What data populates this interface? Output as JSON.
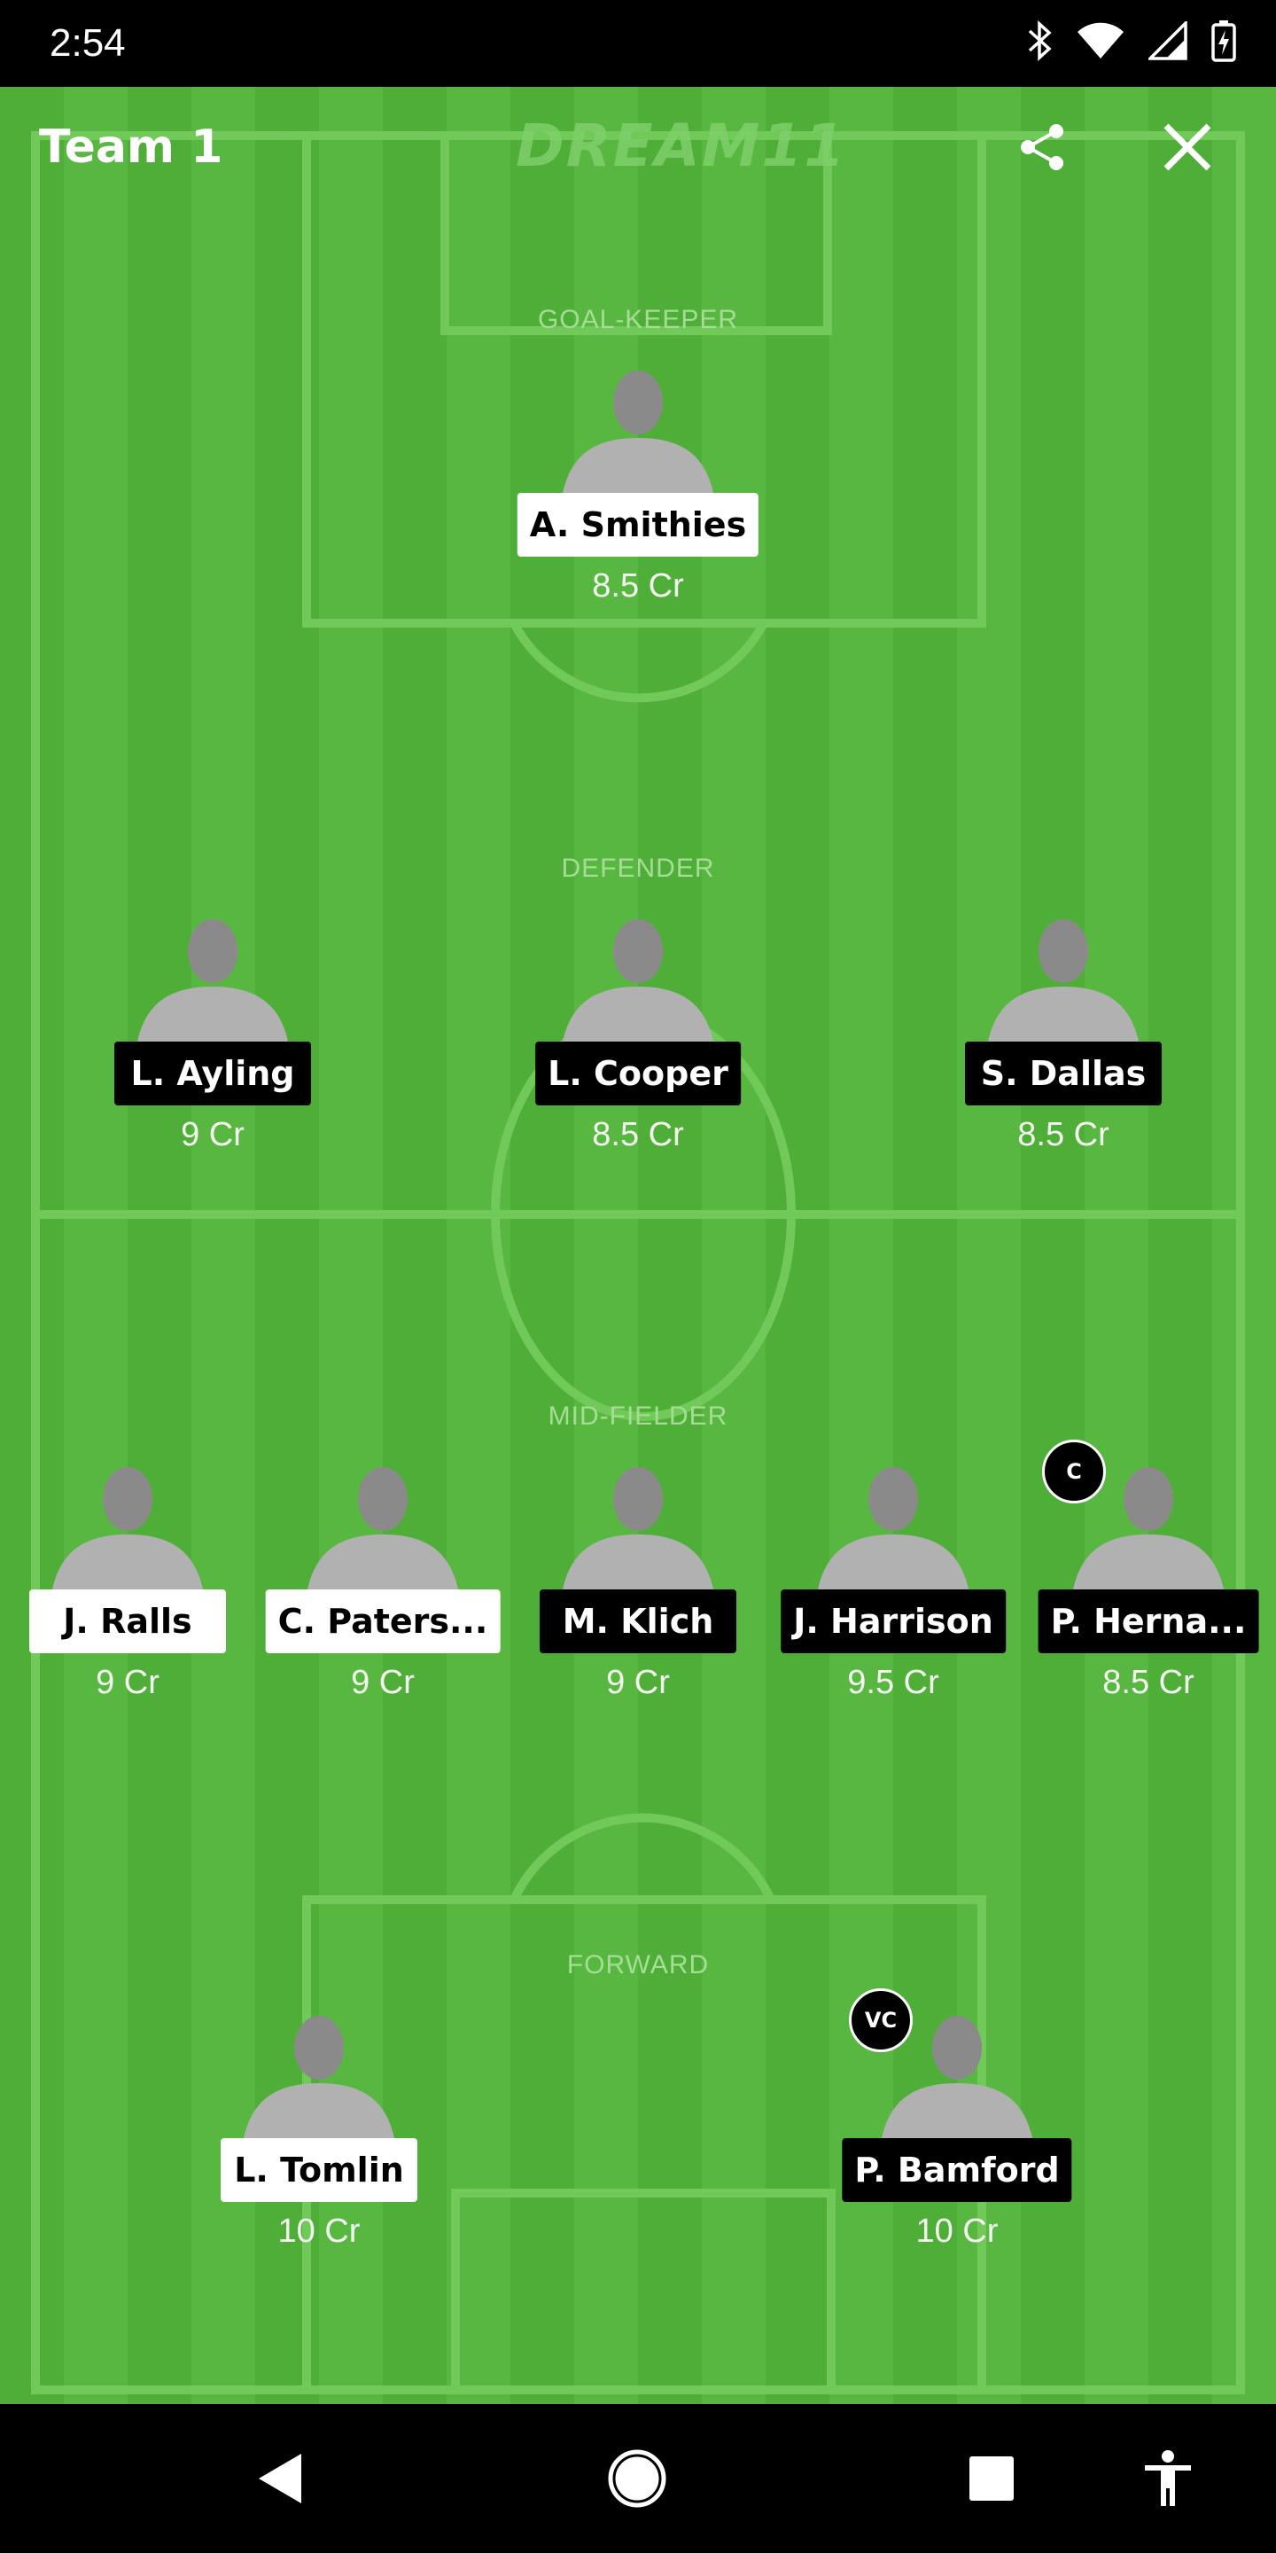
{
  "status": {
    "time": "2:54"
  },
  "header": {
    "team_name": "Team 1",
    "brand": "DREAM11"
  },
  "sections": {
    "goalkeeper": "GOAL-KEEPER",
    "defender": "DEFENDER",
    "midfielder": "MID-FIELDER",
    "forward": "FORWARD"
  },
  "players": {
    "gk": [
      {
        "name": "A. Smithies",
        "credits": "8.5 Cr"
      }
    ],
    "def": [
      {
        "name": "L. Ayling",
        "credits": "9 Cr"
      },
      {
        "name": "L. Cooper",
        "credits": "8.5 Cr"
      },
      {
        "name": "S. Dallas",
        "credits": "8.5 Cr"
      }
    ],
    "mid": [
      {
        "name": "J. Ralls",
        "credits": "9 Cr"
      },
      {
        "name": "C. Paters...",
        "credits": "9 Cr"
      },
      {
        "name": "M. Klich",
        "credits": "9 Cr"
      },
      {
        "name": "J. Harrison",
        "credits": "9.5 Cr"
      },
      {
        "name": "P. Herna...",
        "credits": "8.5 Cr",
        "badge": "C"
      }
    ],
    "fwd": [
      {
        "name": "L. Tomlin",
        "credits": "10 Cr"
      },
      {
        "name": "P. Bamford",
        "credits": "10 Cr",
        "badge": "VC"
      }
    ]
  },
  "icons": {
    "share": "share-icon",
    "close": "close-icon",
    "back": "back-triangle-icon",
    "home": "home-circle-icon",
    "recents": "recents-square-icon",
    "accessibility": "accessibility-icon"
  },
  "colors": {
    "field": "#4fae38",
    "tag_dark": "#000000",
    "tag_light": "#ffffff"
  }
}
